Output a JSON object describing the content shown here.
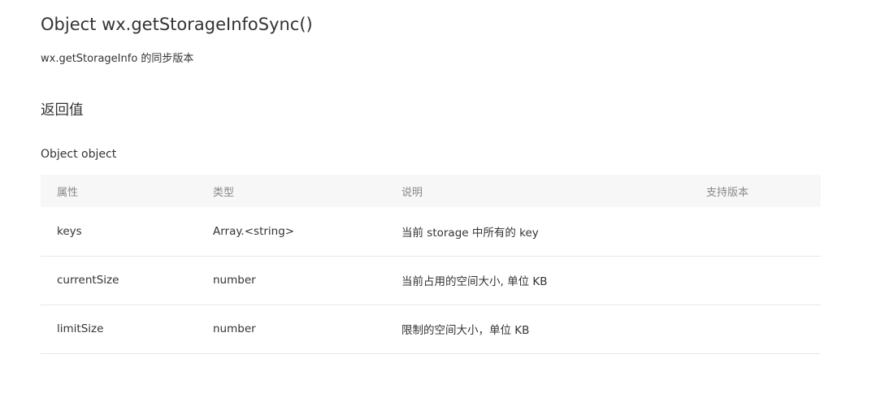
{
  "doc": {
    "title": "Object wx.getStorageInfoSync()",
    "description": "wx.getStorageInfo 的同步版本",
    "return_heading": "返回值",
    "return_type": "Object object"
  },
  "table": {
    "headers": {
      "attribute": "属性",
      "type": "类型",
      "description": "说明",
      "version": "支持版本"
    },
    "rows": [
      {
        "attribute": "keys",
        "type": "Array.<string>",
        "description": "当前 storage 中所有的 key",
        "version": ""
      },
      {
        "attribute": "currentSize",
        "type": "number",
        "description": "当前占用的空间大小, 单位 KB",
        "version": ""
      },
      {
        "attribute": "limitSize",
        "type": "number",
        "description": "限制的空间大小，单位 KB",
        "version": ""
      }
    ]
  }
}
